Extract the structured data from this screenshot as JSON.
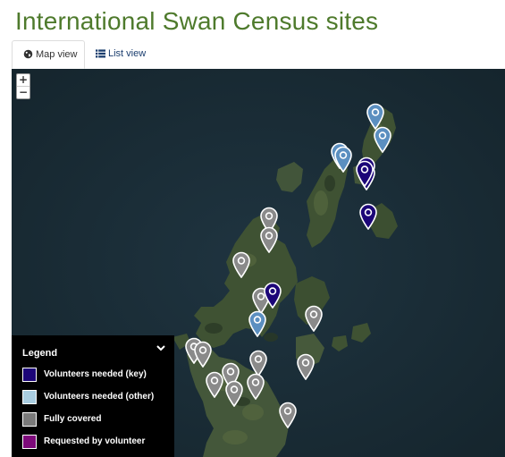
{
  "page": {
    "title": "International Swan Census sites"
  },
  "tabs": [
    {
      "label": "Map view",
      "icon": "globe-icon",
      "active": true
    },
    {
      "label": "List view",
      "icon": "list-icon",
      "active": false
    }
  ],
  "map": {
    "zoom_in_label": "+",
    "zoom_out_label": "−",
    "markers": [
      {
        "category": "other"
      },
      {
        "category": "other"
      },
      {
        "category": "other"
      },
      {
        "category": "key"
      },
      {
        "category": "key"
      },
      {
        "category": "key"
      },
      {
        "category": "other"
      },
      {
        "category": "key"
      },
      {
        "category": "covered"
      },
      {
        "category": "covered"
      },
      {
        "category": "covered"
      },
      {
        "category": "covered"
      },
      {
        "category": "key"
      },
      {
        "category": "other"
      },
      {
        "category": "covered"
      },
      {
        "category": "covered"
      },
      {
        "category": "covered"
      },
      {
        "category": "covered"
      },
      {
        "category": "covered"
      },
      {
        "category": "covered"
      },
      {
        "category": "covered"
      },
      {
        "category": "covered"
      },
      {
        "category": "covered"
      },
      {
        "category": "covered"
      }
    ]
  },
  "legend": {
    "title": "Legend",
    "items": [
      {
        "label": "Volunteers needed (key)",
        "color": "#1c0578"
      },
      {
        "label": "Volunteers needed (other)",
        "color": "#a9cde0"
      },
      {
        "label": "Fully covered",
        "color": "#7a7a7a"
      },
      {
        "label": "Requested by volunteer",
        "color": "#7d0a7a"
      }
    ]
  },
  "colors": {
    "title_green": "#4e7a2c",
    "key": "#1c0578",
    "other": "#5b8fc0",
    "covered": "#8a8a8a",
    "requested": "#7d0a7a"
  }
}
